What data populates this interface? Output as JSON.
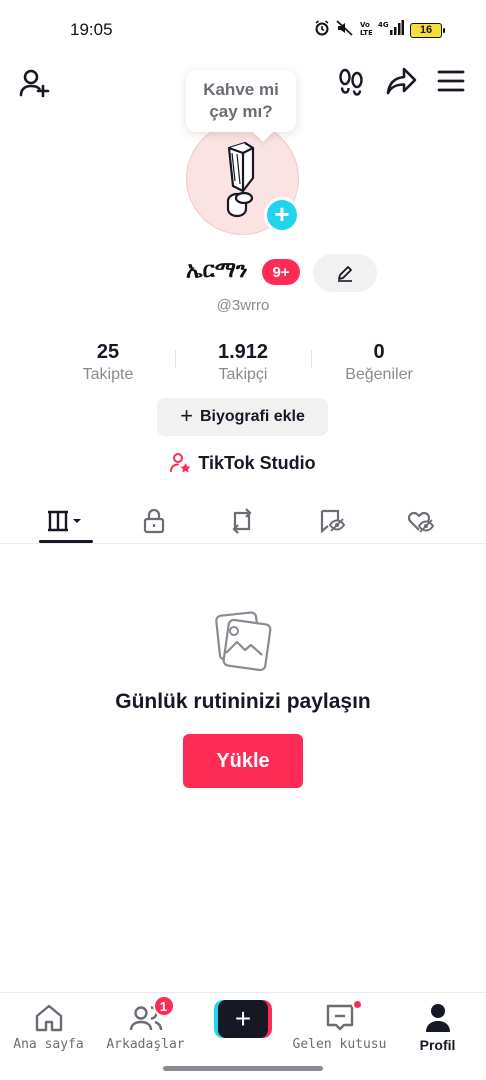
{
  "status_bar": {
    "time": "19:05",
    "battery": "16",
    "icons": [
      "alarm-icon",
      "mute-icon",
      "volte-icon",
      "signal-icon",
      "battery-icon"
    ]
  },
  "header": {
    "add_friend_icon": "person-plus-icon",
    "footprints_icon": "footprints-icon",
    "share_icon": "share-arrow-icon",
    "menu_icon": "hamburger-menu-icon"
  },
  "tooltip": {
    "line1": "Kahve mi",
    "line2": "çay mı?"
  },
  "profile": {
    "username": "ኤርማን",
    "badge": "9+",
    "handle": "@3wrro"
  },
  "stats": [
    {
      "value": "25",
      "label": "Takipte"
    },
    {
      "value": "1.912",
      "label": "Takipçi"
    },
    {
      "value": "0",
      "label": "Beğeniler"
    }
  ],
  "bio_button": {
    "plus": "+",
    "label": "Biyografi ekle"
  },
  "studio": {
    "label": "TikTok Studio"
  },
  "tabs": [
    {
      "icon": "videos-grid-icon",
      "active": true
    },
    {
      "icon": "lock-icon",
      "active": false
    },
    {
      "icon": "repost-icon",
      "active": false
    },
    {
      "icon": "favorites-icon",
      "active": false
    },
    {
      "icon": "liked-icon",
      "active": false
    }
  ],
  "empty_state": {
    "title": "Günlük rutininizi paylaşın",
    "button": "Yükle"
  },
  "bottom_nav": {
    "home": "Ana sayfa",
    "friends": "Arkadaşlar",
    "friends_badge": "1",
    "create": "+",
    "inbox": "Gelen kutusu",
    "profile": "Profil"
  },
  "colors": {
    "accent": "#fe2c55",
    "cyan": "#20d5ec",
    "text": "#161823",
    "muted": "#8a8b91"
  }
}
